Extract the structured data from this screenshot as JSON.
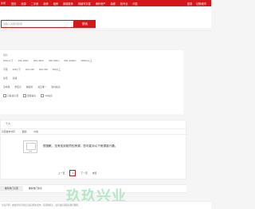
{
  "nav": {
    "logo": "新增",
    "items": [
      "首页",
      "资源",
      "二手房",
      "新房",
      "租房",
      "新楼推荐",
      "商铺写字楼",
      "海外房产",
      "装修",
      "找专业",
      "问答"
    ],
    "right_links": [
      "登录",
      "切换城市"
    ]
  },
  "search": {
    "placeholder": "请输入关键词搜索",
    "button_label": "搜索"
  },
  "filters": {
    "area": {
      "label": "面积",
      "options": [
        "100m以下",
        "100~200m",
        "200~300m",
        "300~500m",
        "500~1000m",
        "1000m以上"
      ]
    },
    "price": {
      "label": "价格",
      "options": [
        "不限",
        "100以下",
        "100~200",
        "200~300",
        "300以上"
      ]
    },
    "type": {
      "label": "类型",
      "options": [
        "住宅",
        "商铺"
      ]
    },
    "feature": {
      "label": "特色",
      "options": [
        "近地铁",
        "学区房",
        "精装修",
        "满五唯一",
        "随时看房"
      ]
    },
    "checks": [
      "只看真房源",
      "视频看房",
      "VR看房"
    ]
  },
  "result": {
    "title": "个人",
    "tabs": [
      "房源发布时间",
      "面积",
      "价格"
    ],
    "empty_text": "很抱歉，没有找到相符的房源，您可能对以下房源感兴趣。",
    "pager": {
      "prev": "上一页",
      "current": "1",
      "next": "下一页",
      "last": "末页"
    }
  },
  "sub_tabs": [
    "推荐热门房源",
    "推荐热门新房"
  ],
  "watermark": "玖玖兴业",
  "footer": "免责声明：本站部分房源信息来自网友发布，请谨慎核实，如有侵权请联系我们删除。"
}
